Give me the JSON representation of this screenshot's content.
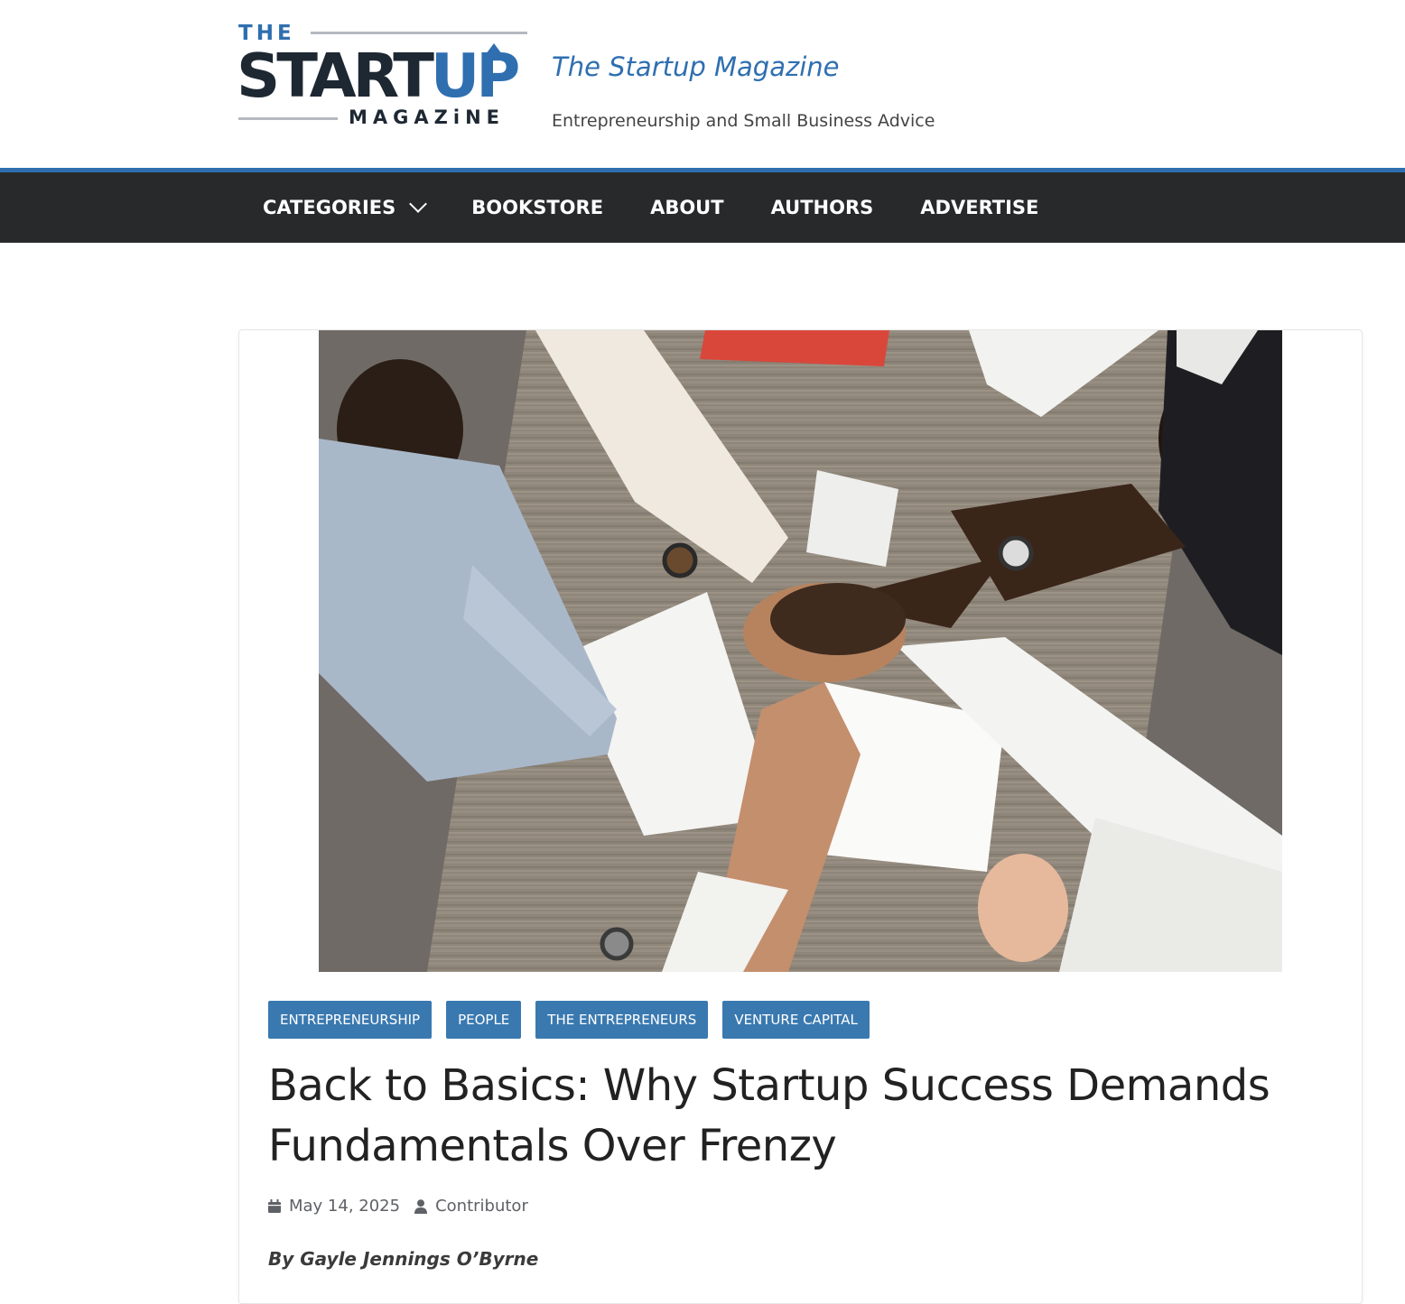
{
  "header": {
    "logo": {
      "the": "THE",
      "start": "START",
      "up": "UP",
      "magazine": "MAGAZiNE"
    },
    "site_title": "The Startup Magazine",
    "tagline": "Entrepreneurship and Small Business Advice"
  },
  "nav": {
    "items": [
      {
        "label": "CATEGORIES",
        "has_dropdown": true
      },
      {
        "label": "BOOKSTORE"
      },
      {
        "label": "ABOUT"
      },
      {
        "label": "AUTHORS"
      },
      {
        "label": "ADVERTISE"
      }
    ]
  },
  "article": {
    "image_alt": "Team members stacking hands together over a wooden meeting table",
    "categories": [
      "ENTREPRENEURSHIP",
      "PEOPLE",
      "THE ENTREPRENEURS",
      "VENTURE CAPITAL"
    ],
    "title": "Back to Basics: Why Startup Success Demands Fundamentals Over Frenzy",
    "date": "May 14, 2025",
    "author": "Contributor",
    "byline": "By Gayle Jennings O’Byrne"
  },
  "colors": {
    "brand_blue": "#2f6fb0",
    "nav_bg": "#27292b",
    "category_bg": "#3a79b0"
  },
  "icons": {
    "date": "calendar-icon",
    "author": "user-icon",
    "dropdown": "chevron-down-icon"
  }
}
